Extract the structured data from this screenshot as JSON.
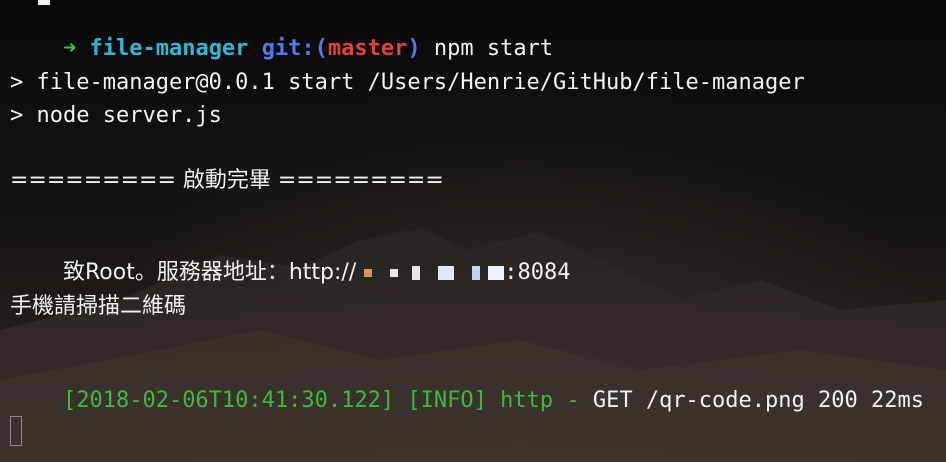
{
  "prompt": {
    "arrow": "➜",
    "directory": "file-manager",
    "git_label": "git:(",
    "branch": "master",
    "git_close": ")",
    "command": "npm start"
  },
  "output": {
    "script_line": "> file-manager@0.0.1 start /Users/Henrie/GitHub/file-manager",
    "node_line": "> node server.js",
    "banner": "========= 啟動完畢 =========",
    "server_address_label": "致Root。服務器地址：http://",
    "server_port": ":8084",
    "qr_hint": "手機請掃描二維碼"
  },
  "log": {
    "timestamp": "[2018-02-06T10:41:30.122]",
    "level": "[INFO]",
    "logger": "http -",
    "request": "GET /qr-code.png 200 22ms"
  }
}
